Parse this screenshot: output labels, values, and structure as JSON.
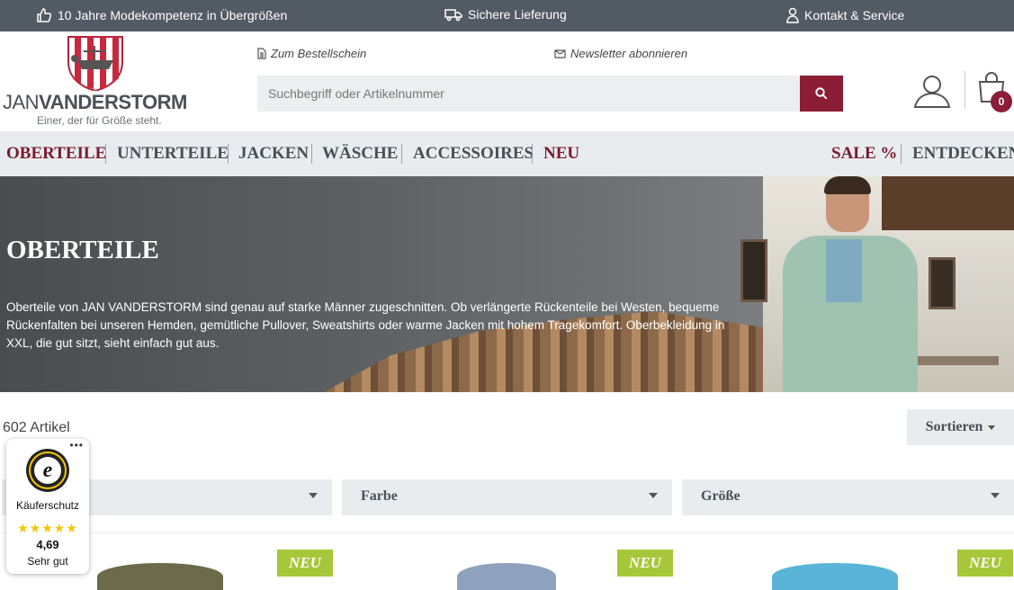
{
  "topbar": {
    "items": [
      {
        "label": "10 Jahre Modekompetenz in Übergrößen",
        "icon": "thumbs-up-icon"
      },
      {
        "label": "Sichere Lieferung",
        "icon": "truck-icon"
      },
      {
        "label": "Kontakt & Service",
        "icon": "person-icon"
      }
    ]
  },
  "header": {
    "logo": {
      "brand_light": "JAN",
      "brand_bold": "VANDERSTORM",
      "tagline": "Einer, der für Größe steht."
    },
    "links": {
      "order_form": "Zum Bestellschein",
      "newsletter": "Newsletter abonnieren"
    },
    "search": {
      "placeholder": "Suchbegriff oder Artikelnummer"
    },
    "cart": {
      "count": "0"
    }
  },
  "nav": {
    "items": [
      "OBERTEILE",
      "UNTERTEILE",
      "JACKEN",
      "WÄSCHE",
      "ACCESSOIRES",
      "NEU"
    ],
    "right_items": [
      "SALE %",
      "ENTDECKEN"
    ]
  },
  "hero": {
    "title": "OBERTEILE",
    "text": "Oberteile von JAN VANDERSTORM sind genau auf starke Männer zugeschnitten. Ob verlängerte Rückenteile bei Westen, bequeme Rückenfalten bei unseren Hemden, gemütliche Pullover, Sweatshirts oder warme Jacken mit hohem Tragekomfort. Oberbekleidung in XXL, die gut sitzt, sieht einfach gut aus."
  },
  "listing": {
    "count": "602 Artikel",
    "sort_label": "Sortieren",
    "filters": [
      "",
      "Farbe",
      "Größe"
    ],
    "badge": "NEU"
  },
  "trust": {
    "label": "Käuferschutz",
    "stars": "★★★★★",
    "score": "4,69",
    "grade": "Sehr gut"
  },
  "colors": {
    "accent": "#8b1d37",
    "topbar": "#525b63",
    "nav_bg": "#e9ecef",
    "new_badge": "#a6c73a"
  }
}
